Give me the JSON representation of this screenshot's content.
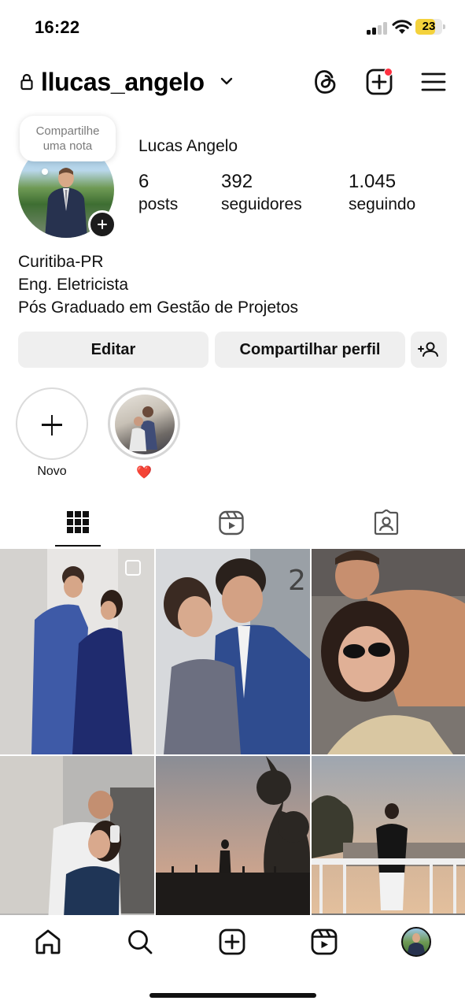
{
  "status_bar": {
    "time": "16:22",
    "battery": "23",
    "battery_level": 0.23
  },
  "header": {
    "username": "llucas_angelo"
  },
  "profile": {
    "note_text": "Compartilhe uma nota",
    "full_name": "Lucas Angelo",
    "stats": [
      {
        "value": "6",
        "label": "posts"
      },
      {
        "value": "392",
        "label": "seguidores"
      },
      {
        "value": "1.045",
        "label": "seguindo"
      }
    ],
    "bio": [
      "Curitiba-PR",
      "Eng. Eletricista",
      "Pós Graduado em Gestão de Projetos"
    ]
  },
  "actions": {
    "edit_label": "Editar",
    "share_label": "Compartilhar perfil"
  },
  "highlights": [
    {
      "label": "Novo"
    },
    {
      "label": "❤️"
    }
  ],
  "tabs": [
    {
      "icon": "grid-icon",
      "active": true
    },
    {
      "icon": "reels-icon",
      "active": false
    },
    {
      "icon": "tagged-icon",
      "active": false
    }
  ],
  "bottom_nav": [
    "home-icon",
    "search-icon",
    "create-icon",
    "reels-icon",
    "profile-avatar"
  ]
}
